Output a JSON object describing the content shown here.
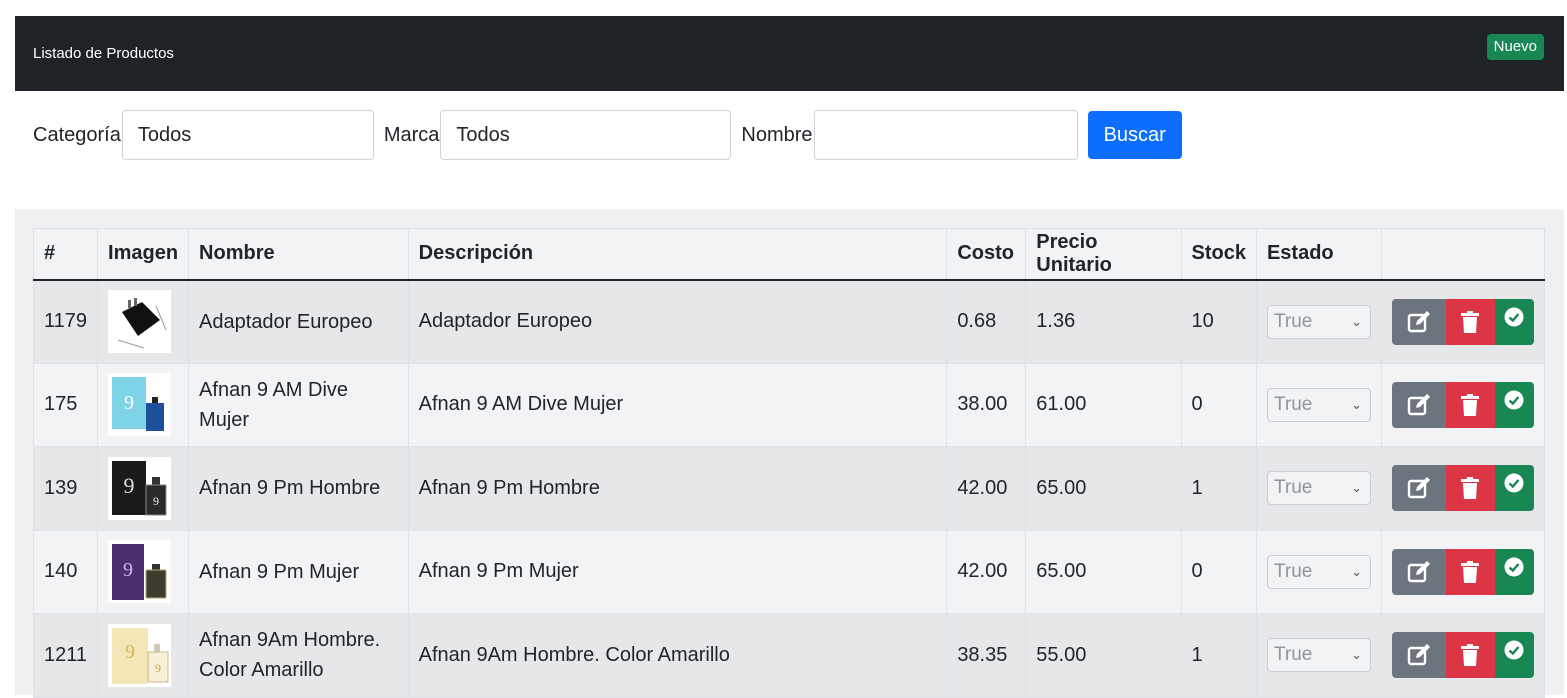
{
  "header": {
    "title": "Listado de Productos",
    "new_button": "Nuevo"
  },
  "filters": {
    "categoria_label": "Categoría",
    "categoria_value": "Todos",
    "marca_label": "Marca",
    "marca_value": "Todos",
    "nombre_label": "Nombre",
    "nombre_value": "",
    "search_button": "Buscar"
  },
  "table": {
    "columns": [
      "#",
      "Imagen",
      "Nombre",
      "Descripción",
      "Costo",
      "Precio Unitario",
      "Stock",
      "Estado",
      ""
    ],
    "rows": [
      {
        "id": "1179",
        "nombre": "Adaptador Europeo",
        "descripcion": "Adaptador Europeo",
        "costo": "0.68",
        "precio": "1.36",
        "stock": "10",
        "estado": "True",
        "image": "adapter-image"
      },
      {
        "id": "175",
        "nombre": "Afnan 9 AM Dive Mujer",
        "descripcion": "Afnan 9 AM Dive Mujer",
        "costo": "38.00",
        "precio": "61.00",
        "stock": "0",
        "estado": "True",
        "image": "perfume-blue-image"
      },
      {
        "id": "139",
        "nombre": "Afnan 9 Pm Hombre",
        "descripcion": "Afnan 9 Pm Hombre",
        "costo": "42.00",
        "precio": "65.00",
        "stock": "1",
        "estado": "True",
        "image": "perfume-black-image"
      },
      {
        "id": "140",
        "nombre": "Afnan 9 Pm Mujer",
        "descripcion": "Afnan 9 Pm Mujer",
        "costo": "42.00",
        "precio": "65.00",
        "stock": "0",
        "estado": "True",
        "image": "perfume-purple-image"
      },
      {
        "id": "1211",
        "nombre": "Afnan 9Am Hombre. Color Amarillo",
        "descripcion": "Afnan 9Am Hombre. Color Amarillo",
        "costo": "38.35",
        "precio": "55.00",
        "stock": "1",
        "estado": "True",
        "image": "perfume-yellow-image"
      }
    ]
  },
  "icons": {
    "edit": "edit-icon",
    "delete": "trash-icon",
    "approve": "check-circle-icon"
  },
  "colors": {
    "header_bg": "#1f2327",
    "primary": "#0d6efd",
    "success": "#198754",
    "danger": "#dc3545",
    "secondary": "#6c757d"
  }
}
